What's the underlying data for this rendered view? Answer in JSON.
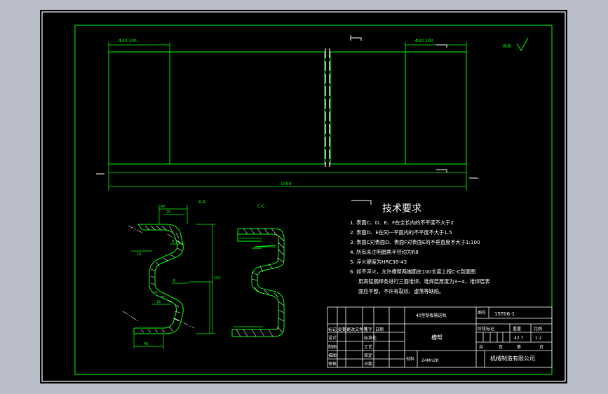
{
  "tech_requirements": {
    "heading": "技术要求",
    "items": [
      "1. 表面C、D、E、F在全长内的不平度不大于2",
      "2. 表面D、E在同一平面内的不平度不大于1.5",
      "3. 表面C对表面D、表面F对表面E的不垂直度不大于1:100",
      "4. 所有未注明圆角半径均为R8",
      "5. 淬火硬度为HRC38-43",
      "6. 如不淬火，允许槽帮两端面在100长度上按C-C剖面图",
      "用高锰钢焊条进行三面堆焊，堆焊层厚度为3~4，堆焊层表",
      "面应平整，不许有裂纹、虚落等缺陷。"
    ]
  },
  "views": {
    "top_dims": [
      "Φ30 100",
      "Φ30 100"
    ],
    "overall_length": "1500",
    "section_a_label": "A-A",
    "section_c_label": "C-C",
    "roughness_mark": "其余"
  },
  "title_block": {
    "project": "40型刮板输送机",
    "drawing_no_label": "图号",
    "drawing_no": "15T06-1",
    "part_name": "槽帮",
    "material_label": "材料",
    "material": "24Mn2K",
    "company": "机械制造有限公司",
    "header_cells": [
      "标记",
      "处数",
      "更改文件号",
      "签字",
      "日期"
    ],
    "sign_rows": [
      "设计",
      "制图",
      "描图",
      "审核"
    ],
    "sign_rows_mid": [
      "标准化",
      "工艺",
      "审定",
      "日期"
    ],
    "stage_labels": [
      "阶段标记",
      "重量",
      "比例"
    ],
    "weight": "42.7",
    "scale": "1:2",
    "sheet_labels": [
      "共",
      "页",
      "第",
      "页"
    ]
  }
}
